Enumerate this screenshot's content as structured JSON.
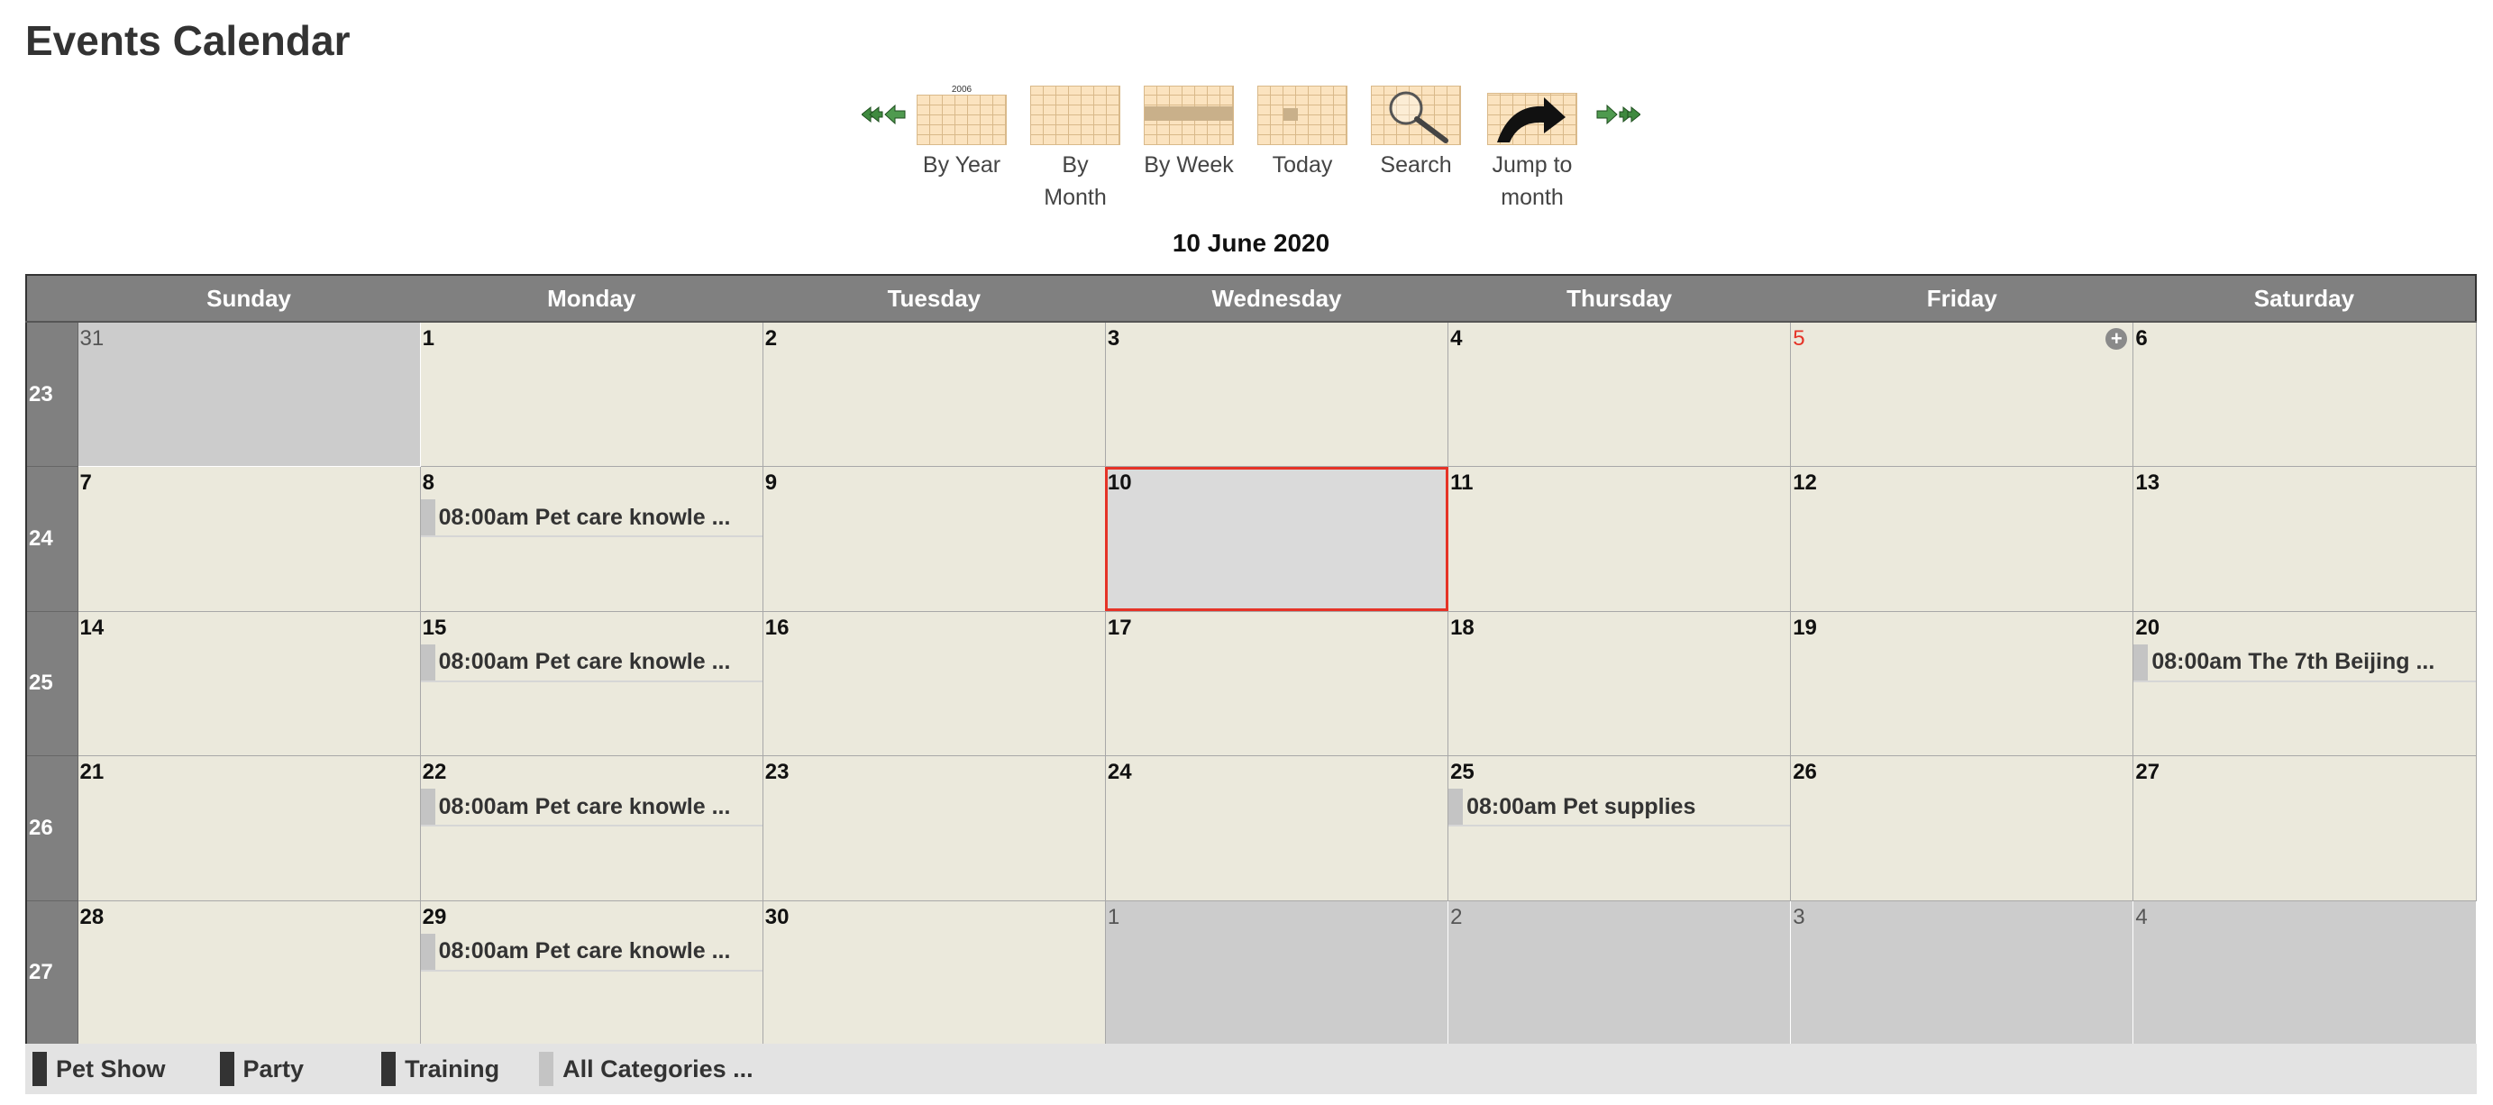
{
  "page": {
    "title": "Events Calendar",
    "current_date": "10 June 2020"
  },
  "nav": {
    "by_year": {
      "label": "By Year",
      "year_tag": "2006"
    },
    "by_month": {
      "label": "By Month"
    },
    "by_week": {
      "label": "By Week"
    },
    "today": {
      "label": "Today"
    },
    "search": {
      "label": "Search"
    },
    "jump": {
      "label": "Jump to month"
    },
    "icons": [
      "double-left-arrow-icon",
      "left-arrow-icon",
      "right-arrow-icon",
      "double-right-arrow-icon"
    ]
  },
  "weekdays": [
    "Sunday",
    "Monday",
    "Tuesday",
    "Wednesday",
    "Thursday",
    "Friday",
    "Saturday"
  ],
  "weeks": [
    {
      "num": "23",
      "days": [
        {
          "d": "31",
          "other": true
        },
        {
          "d": "1"
        },
        {
          "d": "2"
        },
        {
          "d": "3"
        },
        {
          "d": "4"
        },
        {
          "d": "5",
          "holiday": true,
          "add": true
        },
        {
          "d": "6"
        }
      ]
    },
    {
      "num": "24",
      "days": [
        {
          "d": "7"
        },
        {
          "d": "8",
          "events": [
            "08:00am Pet care knowle ..."
          ]
        },
        {
          "d": "9"
        },
        {
          "d": "10",
          "today": true
        },
        {
          "d": "11"
        },
        {
          "d": "12"
        },
        {
          "d": "13"
        }
      ]
    },
    {
      "num": "25",
      "days": [
        {
          "d": "14"
        },
        {
          "d": "15",
          "events": [
            "08:00am Pet care knowle ..."
          ]
        },
        {
          "d": "16"
        },
        {
          "d": "17"
        },
        {
          "d": "18"
        },
        {
          "d": "19"
        },
        {
          "d": "20",
          "events": [
            "08:00am The 7th Beijing ..."
          ]
        }
      ]
    },
    {
      "num": "26",
      "days": [
        {
          "d": "21"
        },
        {
          "d": "22",
          "events": [
            "08:00am Pet care knowle ..."
          ]
        },
        {
          "d": "23"
        },
        {
          "d": "24"
        },
        {
          "d": "25",
          "events": [
            "08:00am Pet supplies"
          ]
        },
        {
          "d": "26"
        },
        {
          "d": "27"
        }
      ]
    },
    {
      "num": "27",
      "days": [
        {
          "d": "28"
        },
        {
          "d": "29",
          "events": [
            "08:00am Pet care knowle ..."
          ]
        },
        {
          "d": "30"
        },
        {
          "d": "1",
          "other": true
        },
        {
          "d": "2",
          "other": true
        },
        {
          "d": "3",
          "other": true
        },
        {
          "d": "4",
          "other": true
        }
      ]
    }
  ],
  "legend": [
    {
      "label": "Pet Show",
      "color": "#333333"
    },
    {
      "label": "Party",
      "color": "#333333"
    },
    {
      "label": "Training",
      "color": "#333333"
    },
    {
      "label": "All Categories ...",
      "color": "#c4c4c4"
    }
  ],
  "colors": {
    "header_bg": "#808080",
    "cell_bg": "#ebe9dc",
    "other_month_bg": "#cccccc",
    "today_border": "#e53327",
    "holiday_text": "#e53327"
  }
}
